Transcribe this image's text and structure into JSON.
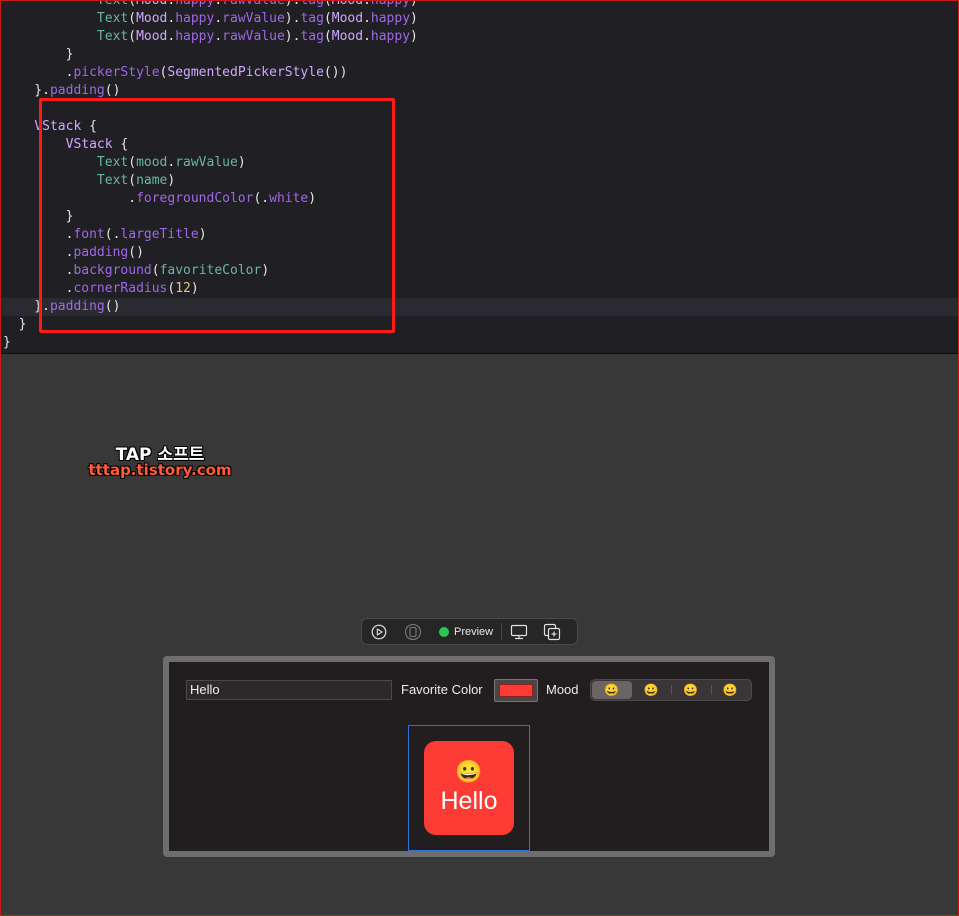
{
  "editor": {
    "lines": [
      [
        {
          "t": "            ",
          "c": "plain"
        },
        {
          "t": "Text",
          "c": "fn"
        },
        {
          "t": "(",
          "c": "plain"
        },
        {
          "t": "Mood",
          "c": "type"
        },
        {
          "t": ".",
          "c": "plain"
        },
        {
          "t": "happy",
          "c": "method"
        },
        {
          "t": ".",
          "c": "plain"
        },
        {
          "t": "rawValue",
          "c": "method"
        },
        {
          "t": ").",
          "c": "plain"
        },
        {
          "t": "tag",
          "c": "method"
        },
        {
          "t": "(",
          "c": "plain"
        },
        {
          "t": "Mood",
          "c": "type"
        },
        {
          "t": ".",
          "c": "plain"
        },
        {
          "t": "happy",
          "c": "method"
        },
        {
          "t": ")",
          "c": "plain"
        }
      ],
      [
        {
          "t": "            ",
          "c": "plain"
        },
        {
          "t": "Text",
          "c": "fn"
        },
        {
          "t": "(",
          "c": "plain"
        },
        {
          "t": "Mood",
          "c": "type"
        },
        {
          "t": ".",
          "c": "plain"
        },
        {
          "t": "happy",
          "c": "method"
        },
        {
          "t": ".",
          "c": "plain"
        },
        {
          "t": "rawValue",
          "c": "method"
        },
        {
          "t": ").",
          "c": "plain"
        },
        {
          "t": "tag",
          "c": "method"
        },
        {
          "t": "(",
          "c": "plain"
        },
        {
          "t": "Mood",
          "c": "type"
        },
        {
          "t": ".",
          "c": "plain"
        },
        {
          "t": "happy",
          "c": "method"
        },
        {
          "t": ")",
          "c": "plain"
        }
      ],
      [
        {
          "t": "            ",
          "c": "plain"
        },
        {
          "t": "Text",
          "c": "fn"
        },
        {
          "t": "(",
          "c": "plain"
        },
        {
          "t": "Mood",
          "c": "type"
        },
        {
          "t": ".",
          "c": "plain"
        },
        {
          "t": "happy",
          "c": "method"
        },
        {
          "t": ".",
          "c": "plain"
        },
        {
          "t": "rawValue",
          "c": "method"
        },
        {
          "t": ").",
          "c": "plain"
        },
        {
          "t": "tag",
          "c": "method"
        },
        {
          "t": "(",
          "c": "plain"
        },
        {
          "t": "Mood",
          "c": "type"
        },
        {
          "t": ".",
          "c": "plain"
        },
        {
          "t": "happy",
          "c": "method"
        },
        {
          "t": ")",
          "c": "plain"
        }
      ],
      [
        {
          "t": "        }",
          "c": "plain"
        }
      ],
      [
        {
          "t": "        .",
          "c": "plain"
        },
        {
          "t": "pickerStyle",
          "c": "method"
        },
        {
          "t": "(",
          "c": "plain"
        },
        {
          "t": "SegmentedPickerStyle",
          "c": "type"
        },
        {
          "t": "())",
          "c": "plain"
        }
      ],
      [
        {
          "t": "    }.",
          "c": "plain"
        },
        {
          "t": "padding",
          "c": "method"
        },
        {
          "t": "()",
          "c": "plain"
        }
      ],
      [
        {
          "t": "",
          "c": "plain"
        }
      ],
      [
        {
          "t": "    ",
          "c": "plain"
        },
        {
          "t": "VStack",
          "c": "type"
        },
        {
          "t": " {",
          "c": "plain"
        }
      ],
      [
        {
          "t": "        ",
          "c": "plain"
        },
        {
          "t": "VStack",
          "c": "type"
        },
        {
          "t": " {",
          "c": "plain"
        }
      ],
      [
        {
          "t": "            ",
          "c": "plain"
        },
        {
          "t": "Text",
          "c": "fn"
        },
        {
          "t": "(",
          "c": "plain"
        },
        {
          "t": "mood",
          "c": "fn"
        },
        {
          "t": ".",
          "c": "plain"
        },
        {
          "t": "rawValue",
          "c": "fn"
        },
        {
          "t": ")",
          "c": "plain"
        }
      ],
      [
        {
          "t": "            ",
          "c": "plain"
        },
        {
          "t": "Text",
          "c": "fn"
        },
        {
          "t": "(",
          "c": "plain"
        },
        {
          "t": "name",
          "c": "fn"
        },
        {
          "t": ")",
          "c": "plain"
        }
      ],
      [
        {
          "t": "                .",
          "c": "plain"
        },
        {
          "t": "foregroundColor",
          "c": "method"
        },
        {
          "t": "(.",
          "c": "plain"
        },
        {
          "t": "white",
          "c": "method"
        },
        {
          "t": ")",
          "c": "plain"
        }
      ],
      [
        {
          "t": "        }",
          "c": "plain"
        }
      ],
      [
        {
          "t": "        .",
          "c": "plain"
        },
        {
          "t": "font",
          "c": "method"
        },
        {
          "t": "(.",
          "c": "plain"
        },
        {
          "t": "largeTitle",
          "c": "method"
        },
        {
          "t": ")",
          "c": "plain"
        }
      ],
      [
        {
          "t": "        .",
          "c": "plain"
        },
        {
          "t": "padding",
          "c": "method"
        },
        {
          "t": "()",
          "c": "plain"
        }
      ],
      [
        {
          "t": "        .",
          "c": "plain"
        },
        {
          "t": "background",
          "c": "method"
        },
        {
          "t": "(",
          "c": "plain"
        },
        {
          "t": "favoriteColor",
          "c": "fn"
        },
        {
          "t": ")",
          "c": "plain"
        }
      ],
      [
        {
          "t": "        .",
          "c": "plain"
        },
        {
          "t": "cornerRadius",
          "c": "method"
        },
        {
          "t": "(",
          "c": "plain"
        },
        {
          "t": "12",
          "c": "num"
        },
        {
          "t": ")",
          "c": "plain"
        }
      ],
      [
        {
          "t": "    }.",
          "c": "plain"
        },
        {
          "t": "padding",
          "c": "method"
        },
        {
          "t": "()",
          "c": "plain"
        }
      ],
      [
        {
          "t": "  }",
          "c": "plain"
        }
      ],
      [
        {
          "t": "}",
          "c": "plain"
        }
      ]
    ],
    "current_line_index": 17
  },
  "watermark": {
    "title": "TAP 소프트",
    "url": "tttap.tistory.com"
  },
  "toolbar": {
    "live_icon": "play-circle-icon",
    "variant_icon": "device-variant-icon",
    "preview_label": "Preview",
    "device_icon": "device-settings-icon",
    "duplicate_icon": "duplicate-preview-icon",
    "status_color": "#2ac955"
  },
  "form": {
    "name_value": "Hello",
    "favorite_label": "Favorite Color",
    "favorite_color": "#fb3b34",
    "mood_label": "Mood",
    "mood_options": [
      "😀",
      "😀",
      "😀",
      "😀"
    ],
    "mood_selected_index": 0
  },
  "card": {
    "emoji": "😀",
    "name": "Hello",
    "background": "#fb3b34"
  }
}
